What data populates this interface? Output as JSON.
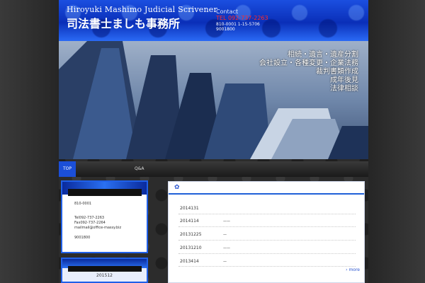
{
  "header": {
    "subtitle": "Hiroyuki Mashimo Judicial Scrivener",
    "title": "司法書士ましも事務所",
    "contact_label": "Contact",
    "phone": "TEL 092-737-2263",
    "address": "810-0001 1-15-5706",
    "hours": "9001800"
  },
  "hero": {
    "lines": [
      "相続・遺言・遺産分割",
      "会社設立・各種変更・企業法務",
      "裁判書類作成",
      "成年後見",
      "法律相談"
    ]
  },
  "nav": {
    "top": "TOP",
    "qa": "Q&A"
  },
  "sidebar": {
    "postal": "810-0001",
    "tel": "Tel092-737-2263",
    "fax": "Fax092-737-2264",
    "mail": "mailmail@office-massy.biz",
    "hours": "9001800",
    "calendar_month": "201512"
  },
  "news": {
    "items": [
      {
        "date": "2014131",
        "title": ""
      },
      {
        "date": "2014114",
        "title": "——"
      },
      {
        "date": "20131225",
        "title": "—"
      },
      {
        "date": "20131210",
        "title": "——"
      },
      {
        "date": "2013414",
        "title": "—"
      }
    ],
    "more": "› more"
  },
  "colors": {
    "accent_blue": "#1b4fd8",
    "phone_red": "#ff2a2a"
  }
}
